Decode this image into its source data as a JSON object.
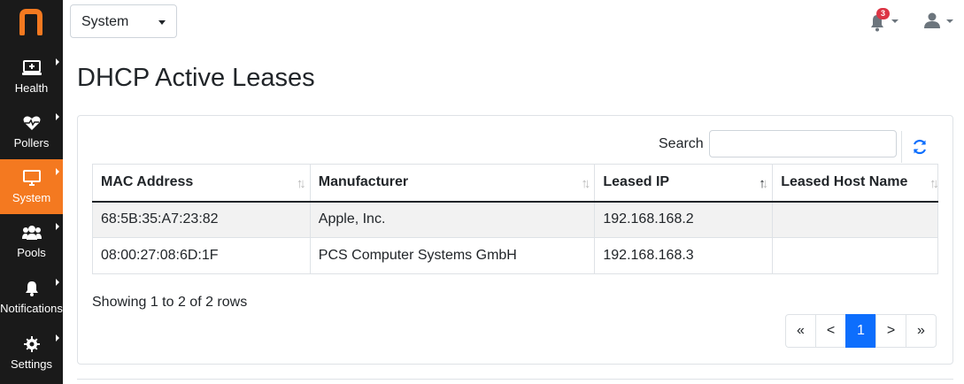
{
  "sidebar": {
    "logo": "n",
    "items": [
      {
        "label": "Health",
        "icon": "monitor-plus-icon",
        "active": false
      },
      {
        "label": "Pollers",
        "icon": "heartbeat-icon",
        "active": false
      },
      {
        "label": "System",
        "icon": "desktop-icon",
        "active": true
      },
      {
        "label": "Pools",
        "icon": "users-icon",
        "active": false
      },
      {
        "label": "Notifications",
        "icon": "bell-icon",
        "active": false
      },
      {
        "label": "Settings",
        "icon": "gear-icon",
        "active": false
      }
    ]
  },
  "header": {
    "selector_value": "System",
    "notification_count": "3"
  },
  "page": {
    "title": "DHCP Active Leases"
  },
  "toolbar": {
    "search_label": "Search",
    "search_value": ""
  },
  "table": {
    "columns": [
      "MAC Address",
      "Manufacturer",
      "Leased IP",
      "Leased Host Name"
    ],
    "rows": [
      [
        "68:5B:35:A7:23:82",
        "Apple, Inc.",
        "192.168.168.2",
        ""
      ],
      [
        "08:00:27:08:6D:1F",
        "PCS Computer Systems GmbH",
        "192.168.168.3",
        ""
      ]
    ],
    "sorted_column": "Leased IP"
  },
  "footer": {
    "showing": "Showing 1 to 2 of 2 rows",
    "pagination": [
      "«",
      "<",
      "1",
      ">",
      "»"
    ],
    "current_page": "1"
  },
  "colors": {
    "accent": "#f47920",
    "sidebar": "#1a1a1a",
    "primary": "#0d6efd",
    "badge": "#dc3545"
  }
}
